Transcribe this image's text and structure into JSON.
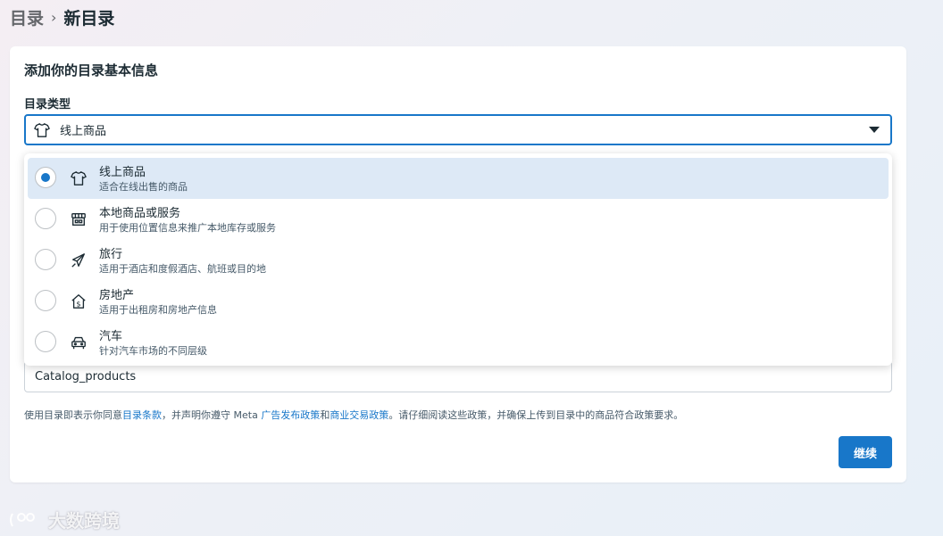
{
  "breadcrumb": {
    "parent": "目录",
    "separator": "›",
    "current": "新目录"
  },
  "card": {
    "title": "添加你的目录基本信息",
    "catalog_type_label": "目录类型",
    "selected_value": "线上商品"
  },
  "options": [
    {
      "title": "线上商品",
      "desc": "适合在线出售的商品",
      "icon": "shirt-icon",
      "selected": true
    },
    {
      "title": "本地商品或服务",
      "desc": "用于使用位置信息来推广本地库存或服务",
      "icon": "store-icon",
      "selected": false
    },
    {
      "title": "旅行",
      "desc": "适用于酒店和度假酒店、航班或目的地",
      "icon": "airplane-icon",
      "selected": false
    },
    {
      "title": "房地产",
      "desc": "适用于出租房和房地产信息",
      "icon": "house-dollar-icon",
      "selected": false
    },
    {
      "title": "汽车",
      "desc": "针对汽车市场的不同层级",
      "icon": "car-icon",
      "selected": false
    }
  ],
  "catalog_name": {
    "value": "Catalog_products"
  },
  "terms": {
    "t1": "使用目录即表示你同意",
    "link1": "目录条款",
    "t2": "，并声明你遵守 Meta ",
    "link2": "广告发布政策",
    "t3": "和",
    "link3": "商业交易政策",
    "t4": "。请仔细阅读这些政策，并确保上传到目录中的商品符合政策要求。"
  },
  "buttons": {
    "continue": "继续"
  },
  "watermark": {
    "text": "大数跨境"
  },
  "colors": {
    "accent": "#1877c9",
    "selected_bg": "#dde9f6"
  }
}
